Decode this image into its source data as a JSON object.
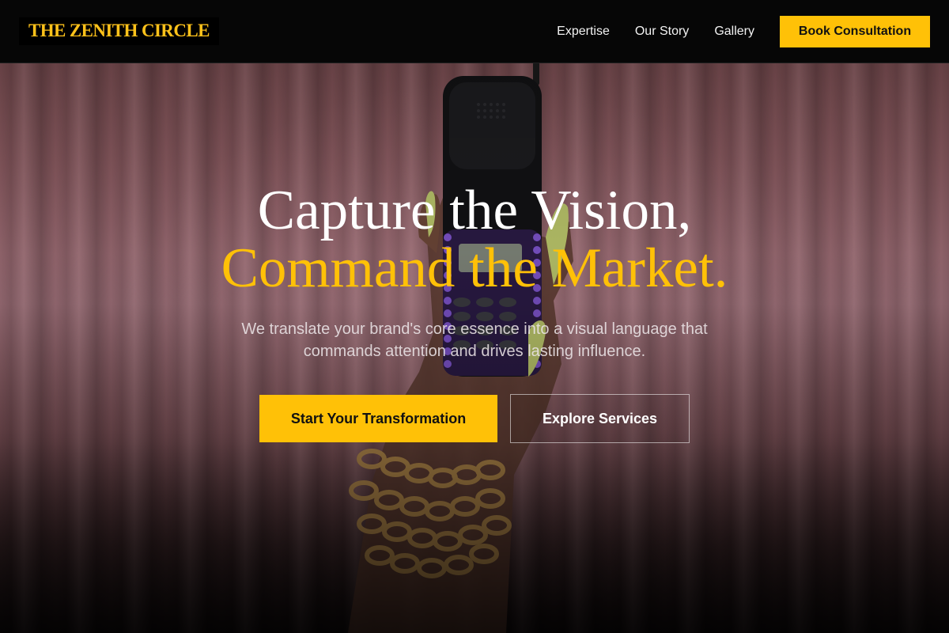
{
  "brand": {
    "logo_text": "THE ZENITH CIRCLE"
  },
  "nav": {
    "links": [
      {
        "label": "Expertise"
      },
      {
        "label": "Our Story"
      },
      {
        "label": "Gallery"
      }
    ],
    "cta_label": "Book Consultation"
  },
  "hero": {
    "headline_line1": "Capture the Vision,",
    "headline_line2": "Command the Market.",
    "subheadline": "We translate your brand's core essence into a visual language that commands attention and drives lasting influence.",
    "primary_button": "Start Your Transformation",
    "secondary_button": "Explore Services",
    "background_image": "hand-holding-flip-phone"
  },
  "colors": {
    "accent": "#ffc107",
    "navbar_bg": "#060606",
    "headline_white": "#ffffff"
  }
}
